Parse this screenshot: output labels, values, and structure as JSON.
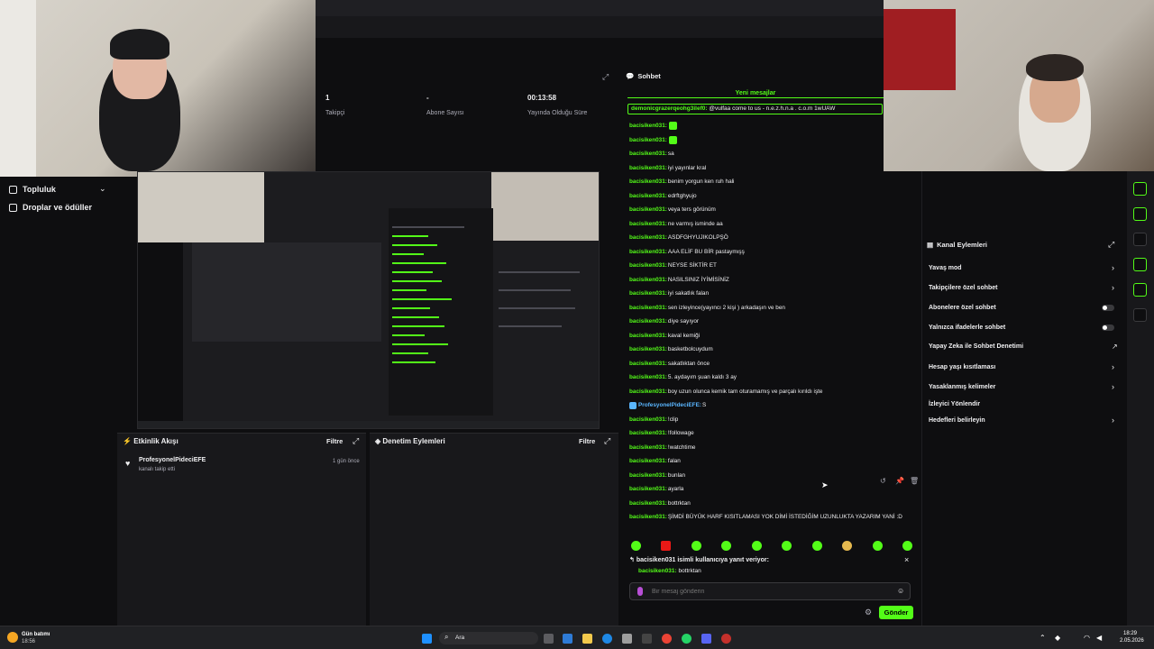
{
  "sidebar": {
    "items": [
      {
        "label": "Topluluk"
      },
      {
        "label": "Droplar ve ödüller"
      }
    ]
  },
  "stats": [
    {
      "value": "1",
      "label": "Takipçi"
    },
    {
      "value": "-",
      "label": "Abone Sayısı"
    },
    {
      "value": "00:13:58",
      "label": "Yayında Olduğu Süre"
    }
  ],
  "activity": {
    "title": "Etkinlik Akışı",
    "filter": "Filtre",
    "entry": {
      "user": "ProfesyonelPideciEFE",
      "action": "kanalı takip etti",
      "time": "1 gün önce"
    }
  },
  "moderation": {
    "title": "Denetim Eylemleri",
    "filter": "Filtre"
  },
  "chat": {
    "title": "Sohbet",
    "new_messages": "Yeni mesajlar",
    "pinned_user": "demonicgrazerqeohg3ilef0:",
    "pinned_text": "@vulfaa come to us - n.e.z.h.n.a . c.o.m 1wUAW",
    "messages": [
      {
        "user": "bacisiken031:",
        "text": ""
      },
      {
        "user": "bacisiken031:",
        "text": ""
      },
      {
        "user": "bacisiken031:",
        "text": "sa"
      },
      {
        "user": "bacisiken031:",
        "text": "iyi yayınlar kral"
      },
      {
        "user": "bacisiken031:",
        "text": "benim yorgun ken ruh hali"
      },
      {
        "user": "bacisiken031:",
        "text": "edrftghyujo"
      },
      {
        "user": "bacisiken031:",
        "text": "veya ters görünüm"
      },
      {
        "user": "bacisiken031:",
        "text": "ne varmış isminde aa"
      },
      {
        "user": "bacisiken031:",
        "text": "ASDFGHYUJIKOLPŞÖ"
      },
      {
        "user": "bacisiken031:",
        "text": "AAA ELİF BU BİR pastaymışş"
      },
      {
        "user": "bacisiken031:",
        "text": "NEYSE SİKTİR ET"
      },
      {
        "user": "bacisiken031:",
        "text": "NASILSINIZ İYİMİSİNİZ"
      },
      {
        "user": "bacisiken031:",
        "text": "iyi sakatlık falan"
      },
      {
        "user": "bacisiken031:",
        "text": "sen izleyince(yayıncı 2 kişi ) arkadaşın ve ben"
      },
      {
        "user": "bacisiken031:",
        "text": "diye sayıyor"
      },
      {
        "user": "bacisiken031:",
        "text": "kaval kemiği"
      },
      {
        "user": "bacisiken031:",
        "text": "basketbolcuydum"
      },
      {
        "user": "bacisiken031:",
        "text": "sakatlıktan önce"
      },
      {
        "user": "bacisiken031:",
        "text": "5. aydayım şuan kaldı 3 ay"
      },
      {
        "user": "bacisiken031:",
        "text": "boy uzun olunca kemik tam oturamamış ve parçalı kırıldı işte"
      },
      {
        "user": "ProfesyonelPideciEFE:",
        "text": "S",
        "mod": true
      },
      {
        "user": "bacisiken031:",
        "text": "!clip"
      },
      {
        "user": "bacisiken031:",
        "text": "!followage"
      },
      {
        "user": "bacisiken031:",
        "text": "!watchtime"
      },
      {
        "user": "bacisiken031:",
        "text": "falan"
      },
      {
        "user": "bacisiken031:",
        "text": "bunlan"
      },
      {
        "user": "bacisiken031:",
        "text": "ayarla"
      },
      {
        "user": "bacisiken031:",
        "text": "bottrktan"
      },
      {
        "user": "bacisiken031:",
        "text": "ŞİMDİ BÜYÜK HARF KISITLAMASI YOK DİMİ İSTEDİĞİM UZUNLUKTA YAZARIM YANİ :D"
      }
    ],
    "reply_title": "bacisiken031 isimli kullanıcıya yanıt veriyor:",
    "reply_user": "bacisiken031:",
    "reply_text": "bottrktan",
    "input_placeholder": "Bir mesaj gönderin",
    "send_label": "Gönder"
  },
  "channel_actions": {
    "title": "Kanal Eylemleri",
    "items": [
      {
        "label": "Yavaş mod"
      },
      {
        "label": "Takipçilere özel sohbet"
      },
      {
        "label": "Abonelere özel sohbet"
      },
      {
        "label": "Yalnızca ifadelerle sohbet"
      },
      {
        "label": "Yapay Zeka ile Sohbet Denetimi"
      },
      {
        "label": "Hesap yaşı kısıtlaması"
      },
      {
        "label": "Yasaklanmış kelimeler"
      },
      {
        "label": "İzleyici Yönlendir"
      },
      {
        "label": "Hedefleri belirleyin"
      }
    ]
  },
  "taskbar": {
    "weather": "Gün batımı",
    "weather_sub": "18:56",
    "search": "Ara",
    "time": "18:29",
    "date": "2.05.2026"
  },
  "colors": {
    "accent": "#53fc18",
    "background": "#0e0e10",
    "panel": "#18181b"
  }
}
